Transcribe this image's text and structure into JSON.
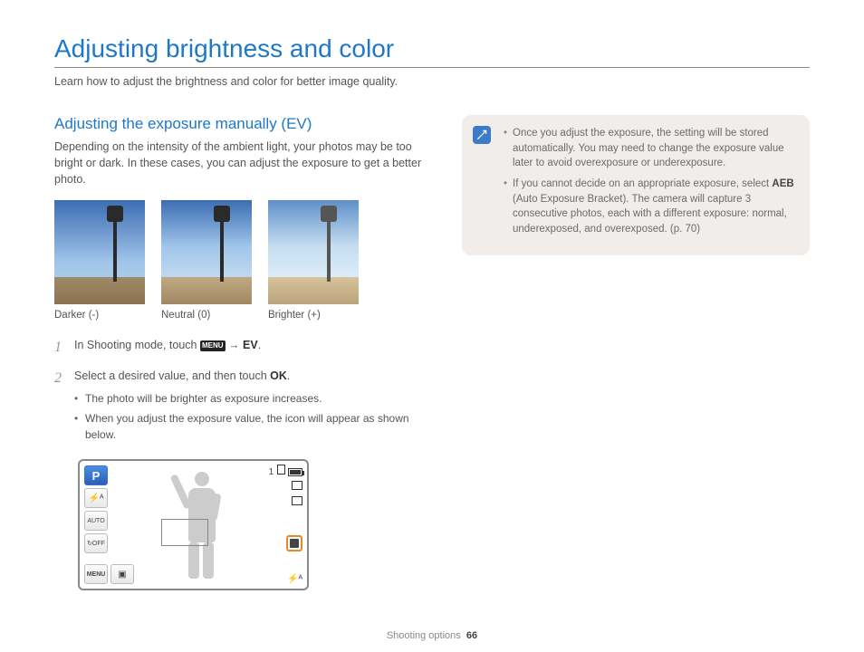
{
  "page": {
    "title": "Adjusting brightness and color",
    "intro": "Learn how to adjust the brightness and color for better image quality."
  },
  "section": {
    "title": "Adjusting the exposure manually (EV)",
    "desc": "Depending on the intensity of the ambient light, your photos may be too bright or dark. In these cases, you can adjust the exposure to get a better photo."
  },
  "photos": {
    "darker": "Darker (-)",
    "neutral": "Neutral (0)",
    "brighter": "Brighter (+)"
  },
  "steps": {
    "s1_num": "1",
    "s1_pre": "In Shooting mode, touch ",
    "s1_menu": "MENU",
    "s1_arrow": " → ",
    "s1_ev": "EV",
    "s1_post": ".",
    "s2_num": "2",
    "s2_pre": "Select a desired value, and then touch ",
    "s2_ok": "OK",
    "s2_post": ".",
    "s2_b1": "The photo will be brighter as exposure increases.",
    "s2_b2": "When you adjust the exposure value, the icon will appear as shown below."
  },
  "callout": {
    "b1": "Once you adjust the exposure, the setting will be stored automatically. You may need to change the exposure value later to avoid overexposure or underexposure.",
    "b2_pre": "If you cannot decide on an appropriate exposure, select ",
    "b2_aeb": "AEB",
    "b2_post": " (Auto Exposure Bracket). The camera will capture 3 consecutive photos, each with a different exposure: normal, underexposed, and overexposed. (p. 70)"
  },
  "camera_ui": {
    "p": "P",
    "flash": "⚡ᴬ",
    "auto": "AUTO",
    "timer": "↻OFF",
    "menu": "MENU",
    "gallery": "▣",
    "count": "1",
    "flash_br": "⚡ᴬ"
  },
  "footer": {
    "section": "Shooting options",
    "page": "66"
  }
}
